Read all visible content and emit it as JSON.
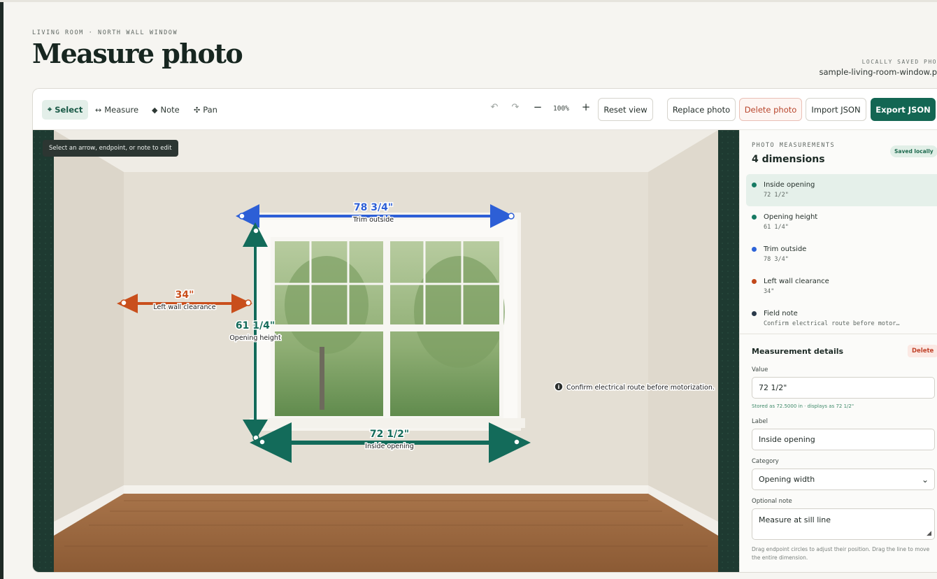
{
  "header": {
    "eyebrow": "LIVING ROOM · NORTH WALL WINDOW",
    "title": "Measure photo",
    "saved_kicker": "LOCALLY SAVED PHO",
    "file_name": "sample-living-room-window.p"
  },
  "toolbar": {
    "tools": [
      {
        "label": "Select",
        "glyph": "⌖",
        "icon": "select-icon",
        "active": true
      },
      {
        "label": "Measure",
        "glyph": "↔",
        "icon": "measure-icon",
        "active": false
      },
      {
        "label": "Note",
        "glyph": "◆",
        "icon": "note-icon",
        "active": false
      },
      {
        "label": "Pan",
        "glyph": "✣",
        "icon": "pan-icon",
        "active": false
      }
    ],
    "undo_glyph": "↶",
    "redo_glyph": "↷",
    "zoom_out_glyph": "−",
    "zoom_in_glyph": "+",
    "zoom_level": "100%",
    "reset_view": "Reset view",
    "replace_photo": "Replace photo",
    "delete_photo": "Delete photo",
    "import_json": "Import JSON",
    "export_json": "Export JSON"
  },
  "canvas": {
    "hint": "Select an arrow, endpoint, or note to edit",
    "annotations": [
      {
        "value": "78 3/4\"",
        "label": "Trim outside",
        "color": "#2d5fd6"
      },
      {
        "value": "61 1/4\"",
        "label": "Opening height",
        "color": "#136b5a"
      },
      {
        "value": "72 1/2\"",
        "label": "Inside opening",
        "color": "#136b5a"
      },
      {
        "value": "34\"",
        "label": "Left wall clearance",
        "color": "#c94f1c"
      }
    ],
    "note_glyph": "i",
    "note_text": "Confirm electrical route before motorization."
  },
  "sidebar": {
    "kicker": "PHOTO MEASUREMENTS",
    "count": "4 dimensions",
    "saved_badge": "Saved locally",
    "items": [
      {
        "name": "Inside opening",
        "value": "72 1/2\"",
        "color": "#167a63",
        "selected": true
      },
      {
        "name": "Opening height",
        "value": "61 1/4\"",
        "color": "#167a63",
        "selected": false
      },
      {
        "name": "Trim outside",
        "value": "78 3/4\"",
        "color": "#2d63d8",
        "selected": false
      },
      {
        "name": "Left wall clearance",
        "value": "34\"",
        "color": "#c2481b",
        "selected": false
      },
      {
        "name": "Field note",
        "value": "Confirm electrical route before motor…",
        "color": "#2a3a4a",
        "selected": false
      }
    ],
    "details": {
      "title": "Measurement details",
      "delete": "Delete",
      "value_label": "Value",
      "value": "72 1/2\"",
      "stored_hint": "Stored as 72.5000 in · displays as 72 1/2\"",
      "label_label": "Label",
      "label_value": "Inside opening",
      "category_label": "Category",
      "category_value": "Opening width",
      "note_label": "Optional note",
      "note_value": "Measure at sill line",
      "help": "Drag endpoint circles to adjust their position. Drag the line to move the entire dimension."
    }
  }
}
